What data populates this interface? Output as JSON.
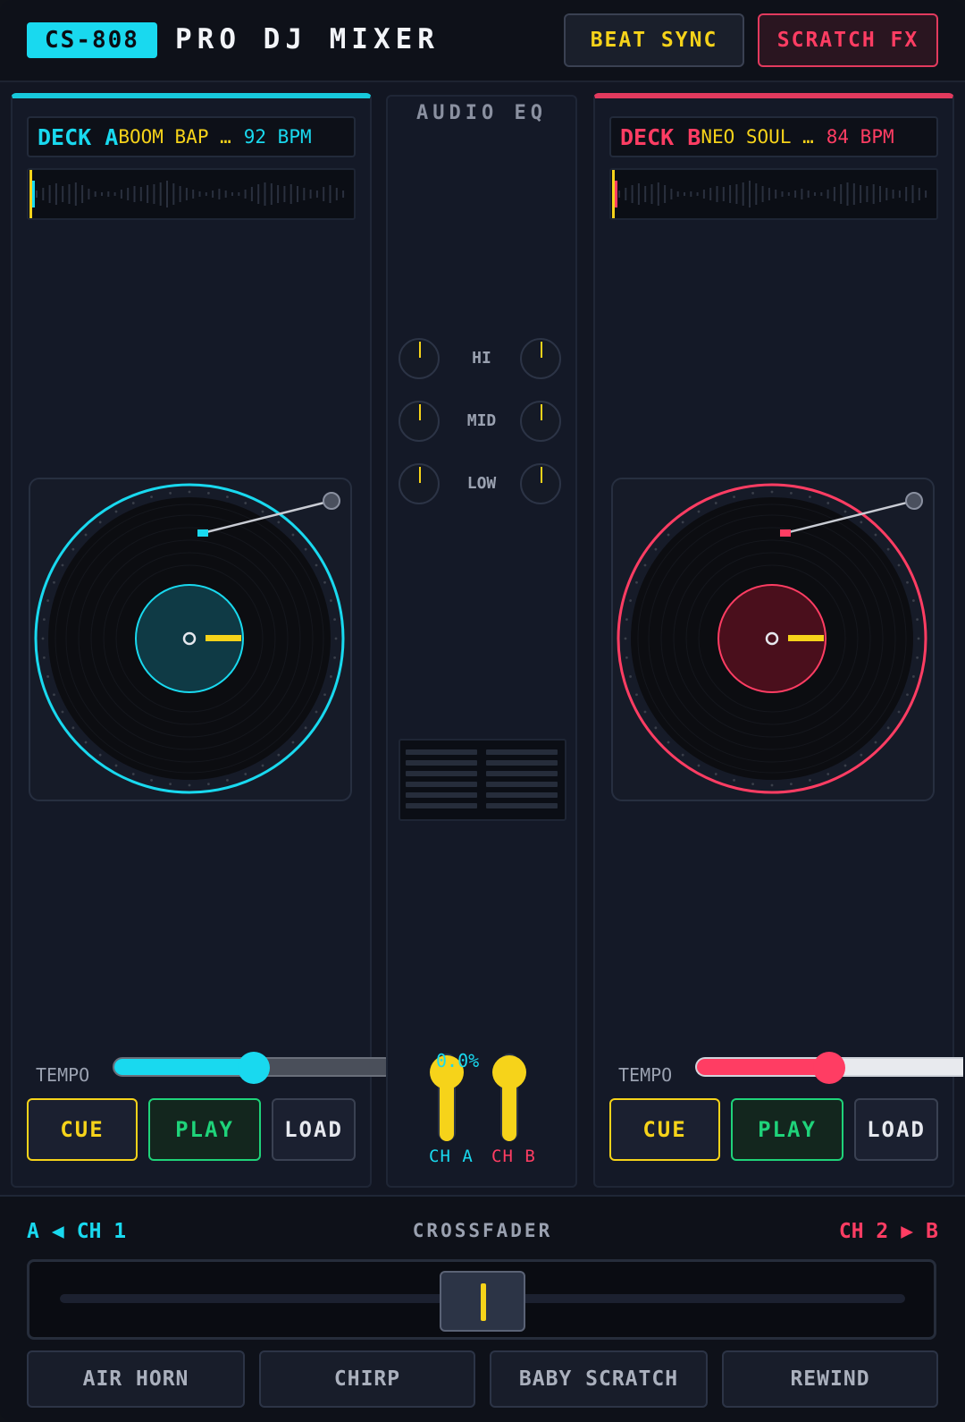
{
  "header": {
    "model": "CS-808",
    "title": "PRO DJ MIXER",
    "beat_sync_label": "BEAT SYNC",
    "scratch_fx_label": "SCRATCH FX"
  },
  "colors": {
    "deck_a_accent": "#19d9ef",
    "deck_b_accent": "#ff3d63",
    "highlight_yellow": "#f6d31a",
    "play_green": "#1fd37a",
    "background": "#121622"
  },
  "deck_a": {
    "label": "DECK A",
    "track": "BOOM BAP …",
    "bpm": "92 BPM",
    "tempo_label": "TEMPO",
    "tempo_position": 0.5,
    "cue_label": "CUE",
    "play_label": "PLAY",
    "load_label": "LOAD"
  },
  "deck_b": {
    "label": "DECK B",
    "track": "NEO SOUL …",
    "bpm": "84 BPM",
    "tempo_label": "TEMPO",
    "tempo_position": 0.5,
    "cue_label": "CUE",
    "play_label": "PLAY",
    "load_label": "LOAD"
  },
  "mixer": {
    "title": "AUDIO EQ",
    "eq_bands": [
      "HI",
      "MID",
      "LOW"
    ],
    "channel_value": "0.0%",
    "ch_a_label": "CH A",
    "ch_b_label": "CH B",
    "ch_a_level": 0.8,
    "ch_b_level": 0.8
  },
  "crossfader": {
    "title": "CROSSFADER",
    "left_deck": "A",
    "left_channel": "CH 1",
    "right_channel": "CH 2",
    "right_deck": "B",
    "position": 0.5
  },
  "fx_pads": [
    "AIR HORN",
    "CHIRP",
    "BABY SCRATCH",
    "REWIND"
  ]
}
